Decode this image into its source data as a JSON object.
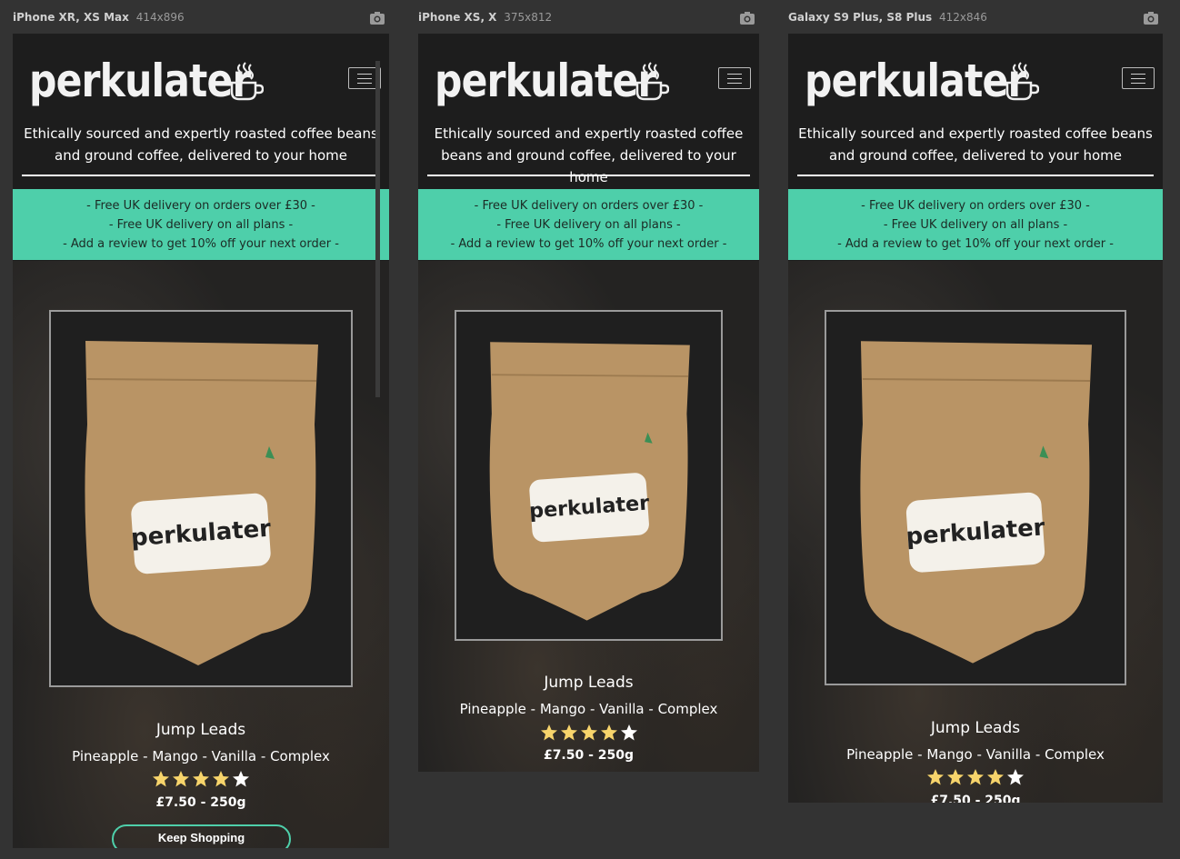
{
  "devices": [
    {
      "name": "iPhone XR, XS Max",
      "size": "414x896"
    },
    {
      "name": "iPhone XS, X",
      "size": "375x812"
    },
    {
      "name": "Galaxy S9 Plus, S8 Plus",
      "size": "412x846"
    }
  ],
  "site": {
    "logo": "perkulater",
    "tagline": "Ethically sourced and expertly roasted coffee beans and ground coffee, delivered to your home",
    "promos": [
      "- Free UK delivery on orders over £30 -",
      "- Free UK delivery on all plans -",
      "- Add a review to get 10% off your next order -"
    ]
  },
  "product": {
    "name": "Jump Leads",
    "notes": "Pineapple - Mango - Vanilla - Complex",
    "rating": 4,
    "rating_max": 5,
    "price": "£7.50 - 250g",
    "bag_label": "perkulater",
    "keep_shopping": "Keep Shopping"
  },
  "colors": {
    "accent": "#4ecfaa",
    "star": "#f7d46b",
    "background": "#1d1d1d"
  },
  "icons": {
    "camera": "camera-icon",
    "menu": "hamburger-menu-icon",
    "cup": "coffee-cup-icon",
    "star": "star-icon"
  }
}
